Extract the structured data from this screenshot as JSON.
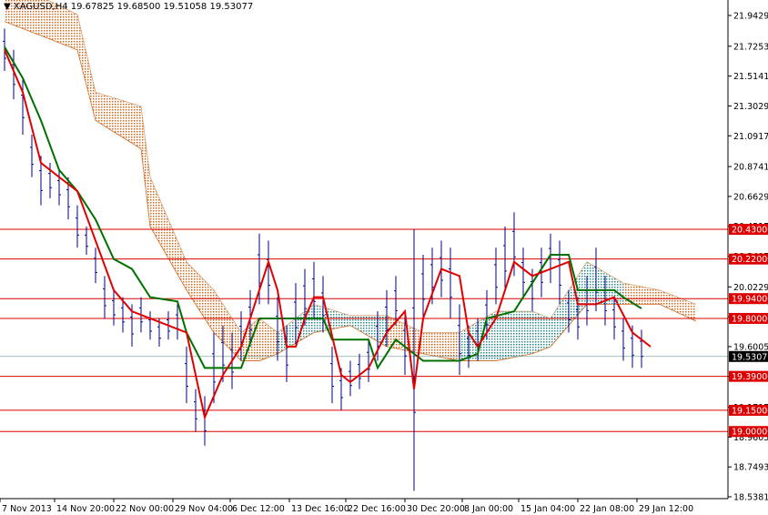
{
  "header": {
    "symbol": "XAGUSD,H4",
    "ohlc": "19.67825 19.68500 19.51058 19.53077"
  },
  "chart_data": {
    "type": "ohlc-bar",
    "title": "XAGUSD,H4",
    "ylim": [
      18.5381,
      21.9429
    ],
    "y_ticks": [
      "21.94290",
      "21.72530",
      "21.51410",
      "21.30290",
      "21.09170",
      "20.87410",
      "20.66290",
      "20.45170",
      "20.24050",
      "20.02290",
      "19.81170",
      "19.60050",
      "19.38930",
      "19.17170",
      "18.96050",
      "18.74930",
      "18.53810"
    ],
    "x_ticks": [
      {
        "index": 0,
        "label": "7 Nov 2013"
      },
      {
        "index": 6,
        "label": "14 Nov 20:00"
      },
      {
        "index": 12.5,
        "label": "22 Nov 00:00"
      },
      {
        "index": 19,
        "label": "29 Nov 04:00"
      },
      {
        "index": 25.3,
        "label": "6 Dec 12:00"
      },
      {
        "index": 31.8,
        "label": "13 Dec 16:00"
      },
      {
        "index": 38,
        "label": "22 Dec 16:00"
      },
      {
        "index": 44.5,
        "label": "30 Dec 20:00"
      },
      {
        "index": 50.8,
        "label": "8 Jan 00:00"
      },
      {
        "index": 57,
        "label": "15 Jan 04:00"
      },
      {
        "index": 63.5,
        "label": "22 Jan 08:00"
      },
      {
        "index": 70,
        "label": "29 Jan 12:00"
      }
    ],
    "levels": [
      {
        "value": 20.43,
        "label": "20.43000"
      },
      {
        "value": 20.22,
        "label": "20.22000"
      },
      {
        "value": 19.94,
        "label": "19.94000"
      },
      {
        "value": 19.8,
        "label": "19.80000"
      },
      {
        "value": 19.39,
        "label": "19.39000"
      },
      {
        "value": 19.15,
        "label": "19.15000"
      },
      {
        "value": 19.0,
        "label": "19.00000"
      }
    ],
    "current_price": {
      "value": 19.53077,
      "label": "19.53077"
    },
    "bars_high_low": [
      [
        21.85,
        21.55
      ],
      [
        21.7,
        21.35
      ],
      [
        21.5,
        21.1
      ],
      [
        21.1,
        20.8
      ],
      [
        20.95,
        20.6
      ],
      [
        20.9,
        20.65
      ],
      [
        20.85,
        20.6
      ],
      [
        20.8,
        20.5
      ],
      [
        20.6,
        20.3
      ],
      [
        20.45,
        20.25
      ],
      [
        20.3,
        20.05
      ],
      [
        20.1,
        19.8
      ],
      [
        20.0,
        19.75
      ],
      [
        19.95,
        19.7
      ],
      [
        19.9,
        19.6
      ],
      [
        19.95,
        19.7
      ],
      [
        19.85,
        19.65
      ],
      [
        19.8,
        19.6
      ],
      [
        19.85,
        19.65
      ],
      [
        19.9,
        19.65
      ],
      [
        19.6,
        19.2
      ],
      [
        19.3,
        19.0
      ],
      [
        19.25,
        18.9
      ],
      [
        19.7,
        19.2
      ],
      [
        19.75,
        19.35
      ],
      [
        19.7,
        19.3
      ],
      [
        19.85,
        19.5
      ],
      [
        20.0,
        19.6
      ],
      [
        20.4,
        19.9
      ],
      [
        20.35,
        19.9
      ],
      [
        19.95,
        19.5
      ],
      [
        19.75,
        19.35
      ],
      [
        20.05,
        19.6
      ],
      [
        20.15,
        19.75
      ],
      [
        20.2,
        19.8
      ],
      [
        20.1,
        19.7
      ],
      [
        19.6,
        19.2
      ],
      [
        19.45,
        19.15
      ],
      [
        19.5,
        19.25
      ],
      [
        19.55,
        19.3
      ],
      [
        19.65,
        19.35
      ],
      [
        19.85,
        19.5
      ],
      [
        20.0,
        19.6
      ],
      [
        20.1,
        19.75
      ],
      [
        19.85,
        19.4
      ],
      [
        20.43,
        18.58
      ],
      [
        20.25,
        19.8
      ],
      [
        20.3,
        19.9
      ],
      [
        20.35,
        19.95
      ],
      [
        20.3,
        19.8
      ],
      [
        19.9,
        19.4
      ],
      [
        19.75,
        19.45
      ],
      [
        19.8,
        19.5
      ],
      [
        20.0,
        19.65
      ],
      [
        20.3,
        19.9
      ],
      [
        20.45,
        20.0
      ],
      [
        20.55,
        20.1
      ],
      [
        20.3,
        19.95
      ],
      [
        20.15,
        19.85
      ],
      [
        20.3,
        19.95
      ],
      [
        20.4,
        20.05
      ],
      [
        20.35,
        19.9
      ],
      [
        20.0,
        19.7
      ],
      [
        19.95,
        19.65
      ],
      [
        20.1,
        19.75
      ],
      [
        20.3,
        19.85
      ],
      [
        20.1,
        19.75
      ],
      [
        19.95,
        19.65
      ],
      [
        19.8,
        19.5
      ],
      [
        19.75,
        19.45
      ],
      [
        19.72,
        19.45
      ]
    ],
    "tenkan": [
      [
        0,
        21.7
      ],
      [
        2,
        21.4
      ],
      [
        4,
        20.9
      ],
      [
        8,
        20.7
      ],
      [
        10,
        20.35
      ],
      [
        12,
        20.0
      ],
      [
        14,
        19.85
      ],
      [
        18,
        19.75
      ],
      [
        20,
        19.7
      ],
      [
        22,
        19.1
      ],
      [
        24,
        19.4
      ],
      [
        26,
        19.6
      ],
      [
        28,
        20.0
      ],
      [
        29,
        20.2
      ],
      [
        30,
        20.0
      ],
      [
        31,
        19.6
      ],
      [
        32,
        19.6
      ],
      [
        33,
        19.8
      ],
      [
        34,
        19.95
      ],
      [
        35,
        19.95
      ],
      [
        37,
        19.4
      ],
      [
        38,
        19.35
      ],
      [
        40,
        19.45
      ],
      [
        42,
        19.7
      ],
      [
        44,
        19.85
      ],
      [
        45,
        19.3
      ],
      [
        46,
        19.8
      ],
      [
        48,
        20.15
      ],
      [
        50,
        20.1
      ],
      [
        51,
        19.7
      ],
      [
        52,
        19.6
      ],
      [
        54,
        19.8
      ],
      [
        56,
        20.2
      ],
      [
        58,
        20.1
      ],
      [
        60,
        20.15
      ],
      [
        62,
        20.2
      ],
      [
        63,
        19.9
      ],
      [
        65,
        19.9
      ],
      [
        67,
        19.95
      ],
      [
        69,
        19.7
      ],
      [
        71,
        19.6
      ]
    ],
    "kijun": [
      [
        0,
        21.72
      ],
      [
        2,
        21.5
      ],
      [
        4,
        21.2
      ],
      [
        6,
        20.85
      ],
      [
        8,
        20.7
      ],
      [
        10,
        20.5
      ],
      [
        12,
        20.22
      ],
      [
        14,
        20.15
      ],
      [
        16,
        19.95
      ],
      [
        19,
        19.92
      ],
      [
        20,
        19.7
      ],
      [
        22,
        19.45
      ],
      [
        26,
        19.45
      ],
      [
        28,
        19.8
      ],
      [
        35,
        19.8
      ],
      [
        36,
        19.65
      ],
      [
        40,
        19.65
      ],
      [
        41,
        19.45
      ],
      [
        43,
        19.65
      ],
      [
        45,
        19.55
      ],
      [
        46,
        19.5
      ],
      [
        50,
        19.5
      ],
      [
        52,
        19.55
      ],
      [
        53,
        19.8
      ],
      [
        56,
        19.85
      ],
      [
        58,
        20.05
      ],
      [
        60,
        20.25
      ],
      [
        62,
        20.25
      ],
      [
        63,
        20.0
      ],
      [
        67,
        20.0
      ],
      [
        68,
        19.95
      ],
      [
        70,
        19.87
      ]
    ],
    "cloud": [
      [
        0,
        22.2,
        21.9
      ],
      [
        8,
        21.95,
        21.7
      ],
      [
        10,
        21.4,
        21.2
      ],
      [
        15,
        21.3,
        21.0
      ],
      [
        16,
        20.8,
        20.45
      ],
      [
        20,
        20.2,
        20.0
      ],
      [
        23,
        20.0,
        19.7
      ],
      [
        26,
        19.7,
        19.5
      ],
      [
        28,
        19.8,
        19.5
      ],
      [
        30,
        19.7,
        19.55
      ],
      [
        34,
        19.9,
        19.7
      ],
      [
        38,
        19.82,
        19.75
      ],
      [
        42,
        19.82,
        19.6
      ],
      [
        46,
        19.7,
        19.55
      ],
      [
        50,
        19.7,
        19.5
      ],
      [
        54,
        19.85,
        19.5
      ],
      [
        58,
        19.85,
        19.55
      ],
      [
        60,
        19.8,
        19.6
      ],
      [
        64,
        20.2,
        19.9
      ],
      [
        68,
        20.05,
        19.9
      ],
      [
        72,
        20.0,
        19.9
      ],
      [
        76,
        19.9,
        19.78
      ]
    ],
    "bullish_cloud_ranges": [
      [
        30,
        42
      ],
      [
        50,
        66
      ]
    ],
    "colors": {
      "bars": "#00007f",
      "tenkan": "#e00000",
      "kijun": "#007000",
      "level": "#dd0000",
      "cloud_bear": "#d2691e",
      "cloud_bull": "#2e8b8b",
      "current": "#000000"
    }
  }
}
